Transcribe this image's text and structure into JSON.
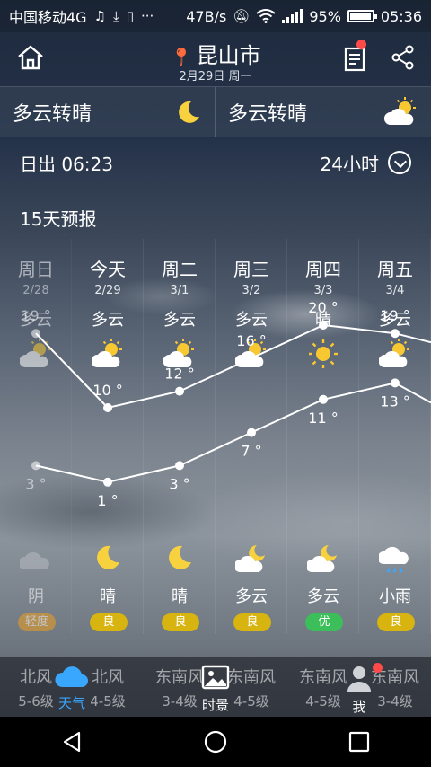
{
  "status": {
    "carrier": "中国移动4G",
    "speed": "47B/s",
    "battery": "95%",
    "time": "05:36",
    "net_badge": "4G"
  },
  "header": {
    "city": "昆山市",
    "date": "2月29日 周一"
  },
  "today_strip": {
    "today": {
      "label": "多云转晴",
      "icon": "moon-icon"
    },
    "tomorrow": {
      "label": "多云转晴",
      "icon": "partly-cloudy-icon"
    }
  },
  "sun": {
    "sunrise": "日出 06:23",
    "toggle_label": "24小时"
  },
  "forecast": {
    "title": "15天预报",
    "days": [
      {
        "weekday": "周日",
        "date": "2/28",
        "day_cond": "多云",
        "day_icon": "partly-cloudy-icon",
        "high": "19 °",
        "low": "3 °",
        "high_v": 19,
        "low_v": 3,
        "night_cond": "阴",
        "night_icon": "cloudy-icon",
        "aqi": "轻度",
        "aqi_color": "#f0a020",
        "wind_dir": "北风",
        "wind_lvl": "5-6级",
        "past": true
      },
      {
        "weekday": "今天",
        "date": "2/29",
        "day_cond": "多云",
        "day_icon": "partly-cloudy-icon",
        "high": "10 °",
        "low": "1 °",
        "high_v": 10,
        "low_v": 1,
        "night_cond": "晴",
        "night_icon": "moon-icon",
        "aqi": "良",
        "aqi_color": "#d8b410",
        "wind_dir": "北风",
        "wind_lvl": "4-5级",
        "past": false
      },
      {
        "weekday": "周二",
        "date": "3/1",
        "day_cond": "多云",
        "day_icon": "partly-cloudy-icon",
        "high": "12 °",
        "low": "3 °",
        "high_v": 12,
        "low_v": 3,
        "night_cond": "晴",
        "night_icon": "moon-icon",
        "aqi": "良",
        "aqi_color": "#d8b410",
        "wind_dir": "东南风",
        "wind_lvl": "3-4级",
        "past": false
      },
      {
        "weekday": "周三",
        "date": "3/2",
        "day_cond": "多云",
        "day_icon": "partly-cloudy-icon",
        "high": "16 °",
        "low": "7 °",
        "high_v": 16,
        "low_v": 7,
        "night_cond": "多云",
        "night_icon": "cloudy-moon-icon",
        "aqi": "良",
        "aqi_color": "#d8b410",
        "wind_dir": "东南风",
        "wind_lvl": "4-5级",
        "past": false
      },
      {
        "weekday": "周四",
        "date": "3/3",
        "day_cond": "晴",
        "day_icon": "sun-icon",
        "high": "20 °",
        "low": "11 °",
        "high_v": 20,
        "low_v": 11,
        "night_cond": "多云",
        "night_icon": "cloudy-moon-icon",
        "aqi": "优",
        "aqi_color": "#3cbf5a",
        "wind_dir": "东南风",
        "wind_lvl": "4-5级",
        "past": false
      },
      {
        "weekday": "周五",
        "date": "3/4",
        "day_cond": "多云",
        "day_icon": "partly-cloudy-icon",
        "high": "19 °",
        "low": "13 °",
        "high_v": 19,
        "low_v": 13,
        "night_cond": "小雨",
        "night_icon": "rain-icon",
        "aqi": "良",
        "aqi_color": "#d8b410",
        "wind_dir": "东南风",
        "wind_lvl": "3-4级",
        "past": false
      }
    ]
  },
  "nav": {
    "weather": "天气",
    "scenes": "时景",
    "me": "我"
  },
  "colors": {
    "accent": "#3aa7ff",
    "pin": "#ff6a3d",
    "badge": "#ff4a4a"
  }
}
